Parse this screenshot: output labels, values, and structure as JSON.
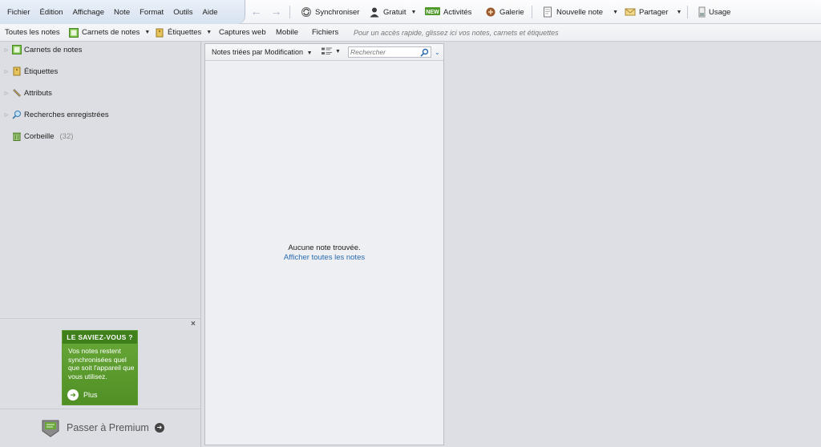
{
  "menu": {
    "items": [
      "Fichier",
      "Édition",
      "Affichage",
      "Note",
      "Format",
      "Outils",
      "Aide"
    ]
  },
  "toolbar": {
    "sync_label": "Synchroniser",
    "account_label": "Gratuit",
    "activity_label": "Activités",
    "activity_badge": "NEW",
    "gallery_label": "Galerie",
    "new_note_label": "Nouvelle note",
    "share_label": "Partager",
    "usage_label": "Usage"
  },
  "shortcuts": {
    "all_notes": "Toutes les notes",
    "notebooks": "Carnets de notes",
    "tags": "Étiquettes",
    "web_clips": "Captures web",
    "mobile": "Mobile",
    "files": "Fichiers",
    "hint": "Pour un accès rapide, glissez ici vos notes, carnets et étiquettes"
  },
  "sidebar": {
    "items": [
      {
        "label": "Carnets de notes"
      },
      {
        "label": "Étiquettes"
      },
      {
        "label": "Attributs"
      },
      {
        "label": "Recherches enregistrées"
      },
      {
        "label": "Corbeille",
        "count": "(32)"
      }
    ]
  },
  "promo": {
    "close": "×",
    "title": "LE SAVIEZ-VOUS ?",
    "body": "Vos notes restent synchronisées quel que soit l'appareil que vous utilisez.",
    "more": "Plus"
  },
  "premium": {
    "label": "Passer à Premium"
  },
  "notelist": {
    "sort_label": "Notes triées par Modification",
    "search_placeholder": "Rechercher",
    "empty_message": "Aucune note trouvée.",
    "show_all_link": "Afficher toutes les notes"
  },
  "colors": {
    "link": "#2a6bb0",
    "promo_green": "#4f8f24",
    "background": "#dddfe5"
  }
}
